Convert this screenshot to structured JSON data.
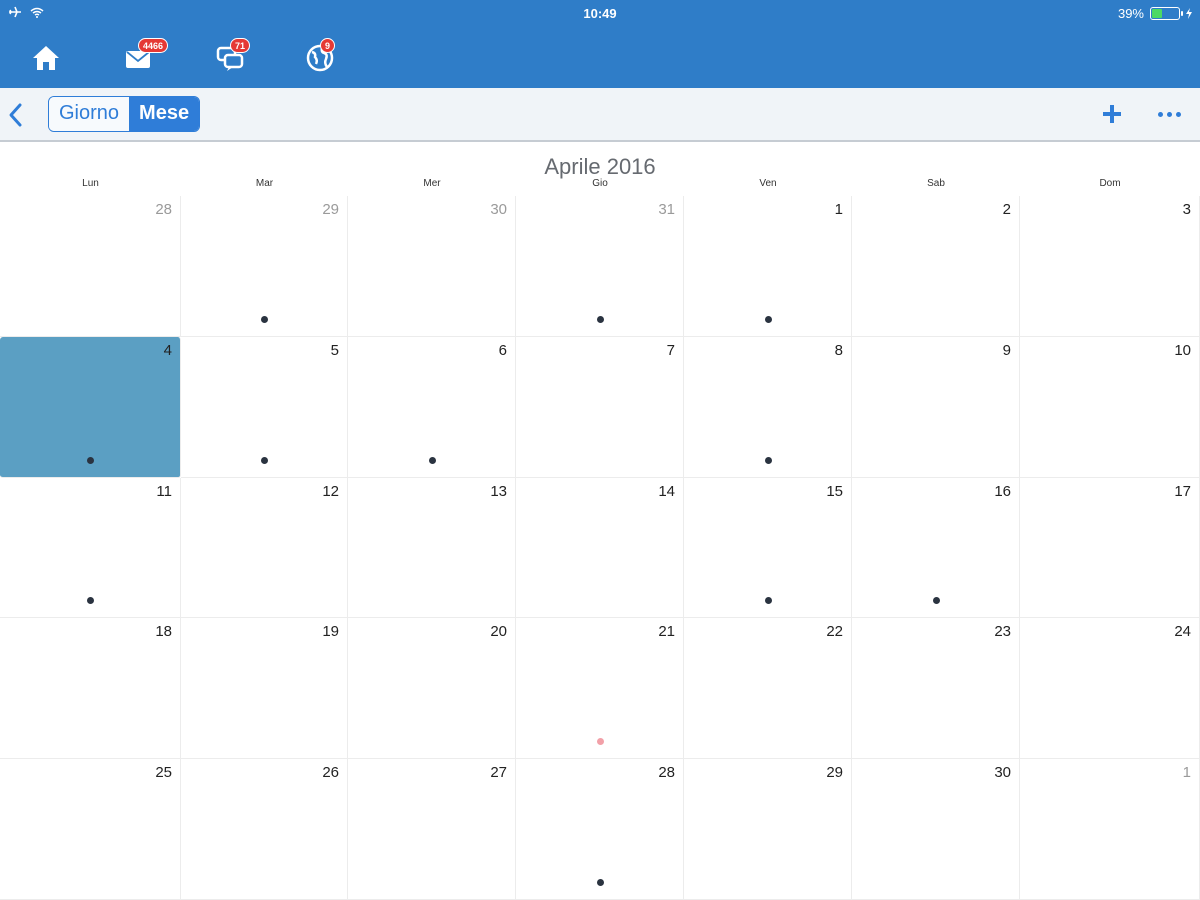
{
  "status_bar": {
    "time": "10:49",
    "battery": "39%",
    "battery_level": 0.39
  },
  "app_nav": {
    "items": [
      {
        "icon": "home-icon",
        "badge": ""
      },
      {
        "icon": "mail-icon",
        "badge": "4466"
      },
      {
        "icon": "chat-icon",
        "badge": "71"
      },
      {
        "icon": "globe-icon",
        "badge": "9"
      }
    ]
  },
  "toolbar": {
    "segments": [
      {
        "label": "Giorno",
        "active": false
      },
      {
        "label": "Mese",
        "active": true
      }
    ]
  },
  "calendar": {
    "month_title": "Aprile 2016",
    "weekdays": [
      "Lun",
      "Mar",
      "Mer",
      "Gio",
      "Ven",
      "Sab",
      "Dom"
    ],
    "weeks": [
      [
        {
          "day": "28",
          "other": true,
          "dot": ""
        },
        {
          "day": "29",
          "other": true,
          "dot": "dark"
        },
        {
          "day": "30",
          "other": true,
          "dot": ""
        },
        {
          "day": "31",
          "other": true,
          "dot": "dark"
        },
        {
          "day": "1",
          "other": false,
          "dot": "dark"
        },
        {
          "day": "2",
          "other": false,
          "dot": ""
        },
        {
          "day": "3",
          "other": false,
          "dot": ""
        }
      ],
      [
        {
          "day": "4",
          "other": false,
          "dot": "dark",
          "selected": true
        },
        {
          "day": "5",
          "other": false,
          "dot": "dark"
        },
        {
          "day": "6",
          "other": false,
          "dot": "dark"
        },
        {
          "day": "7",
          "other": false,
          "dot": ""
        },
        {
          "day": "8",
          "other": false,
          "dot": "dark"
        },
        {
          "day": "9",
          "other": false,
          "dot": ""
        },
        {
          "day": "10",
          "other": false,
          "dot": ""
        }
      ],
      [
        {
          "day": "11",
          "other": false,
          "dot": "dark"
        },
        {
          "day": "12",
          "other": false,
          "dot": ""
        },
        {
          "day": "13",
          "other": false,
          "dot": ""
        },
        {
          "day": "14",
          "other": false,
          "dot": ""
        },
        {
          "day": "15",
          "other": false,
          "dot": "dark"
        },
        {
          "day": "16",
          "other": false,
          "dot": "dark"
        },
        {
          "day": "17",
          "other": false,
          "dot": ""
        }
      ],
      [
        {
          "day": "18",
          "other": false,
          "dot": ""
        },
        {
          "day": "19",
          "other": false,
          "dot": ""
        },
        {
          "day": "20",
          "other": false,
          "dot": ""
        },
        {
          "day": "21",
          "other": false,
          "dot": "pink"
        },
        {
          "day": "22",
          "other": false,
          "dot": ""
        },
        {
          "day": "23",
          "other": false,
          "dot": ""
        },
        {
          "day": "24",
          "other": false,
          "dot": ""
        }
      ],
      [
        {
          "day": "25",
          "other": false,
          "dot": ""
        },
        {
          "day": "26",
          "other": false,
          "dot": ""
        },
        {
          "day": "27",
          "other": false,
          "dot": ""
        },
        {
          "day": "28",
          "other": false,
          "dot": "dark"
        },
        {
          "day": "29",
          "other": false,
          "dot": ""
        },
        {
          "day": "30",
          "other": false,
          "dot": ""
        },
        {
          "day": "1",
          "other": true,
          "dot": ""
        }
      ]
    ]
  },
  "colors": {
    "header_blue": "#2f7dc8",
    "accent": "#2f7dd8",
    "selected_day": "#5b9fc3",
    "badge_red": "#e53935",
    "event_dot": "#2a3340",
    "event_dot_alt": "#f2a0a8"
  }
}
